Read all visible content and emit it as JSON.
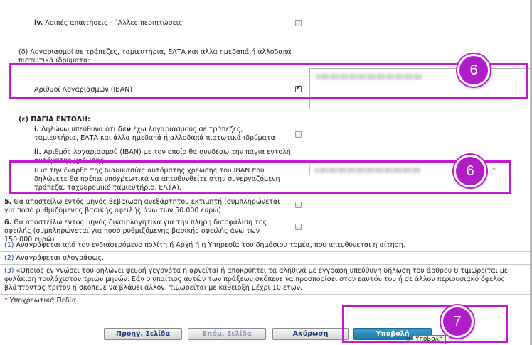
{
  "form": {
    "item_iv": {
      "num": "iv.",
      "label": "Λοιπές απαιτήσεις - ˙Αλλες περιπτώσεις"
    },
    "section_d": {
      "label": "(δ) Λογαριασμοί σε τράπεζες, ταμιευτήρια, ΕΛΤΑ και άλλα ημεδαπά ή αλλοδαπά πιστωτικά ιδρύματα:",
      "iban_label": "Αριθμοί Λογαριασμών (IBAN)",
      "iban_checked": true
    },
    "section_e": {
      "title": "(ε) ΠΑΓΙΑ ΕΝΤΟΛΗ:",
      "item_i_num": "i.",
      "item_i_a": "Δηλώνω υπεύθυνα ότι",
      "item_i_bold": "δεν",
      "item_i_b": "έχω λογαριασμούς σε τράπεζες, ταμιευτήρια, ΕΛΤΑ και άλλα ημεδαπά ή αλλοδαπά πιστωτικά ιδρύματα",
      "item_ii_num": "ii.",
      "item_ii_text": "Αριθμός λογαριασμού (IBAN) με τον οποίο θα συνδέσω την πάγια εντολή αυτόματης χρέωσης.",
      "item_ii_note": "(Για την έναρξη της διαδικασίας αυτόματης χρέωσης του IBAN που δηλώνετε θα πρέπει υποχρεωτικά να απευθυνθείτε στην συνεργαζόμενη τράπεζα, ταχυδρομικό ταμιευτήριο, ΕΛΤΑ).",
      "required_mark": "*"
    },
    "item_5": {
      "num": "5.",
      "text": "Θα αποστείλω εντός μηνός βεβαίωση ανεξάρτητου εκτιμητή (συμπληρώνεται για ποσό ρυθμιζόμενης βασικής οφειλής άνω των 50.000 ευρώ)"
    },
    "item_6": {
      "num": "6.",
      "text": "Θα αποστείλω εντός μηνός δικαιολογητικά για την πλήρη διασφάλιση της οφειλής (συμπληρώνεται για ποσό ρυθμιζόμενης βασικής οφειλής άνω των 150.000 ευρώ)"
    }
  },
  "notes": [
    {
      "num": "(1)",
      "text": "Αναγράφεται από τον ενδιαφερόμενο πολίτη ή Αρχή ή η Υπηρεσία του δημόσιου τομέα, που απευθύνεται η αίτηση."
    },
    {
      "num": "(2)",
      "text": "Αναγράφεται ολογράφως."
    },
    {
      "num": "(3)",
      "text": "«Όποιος εν γνώσει του δηλώνει ψευδή γεγονότα ή αρνείται ή αποκρύπτει τα αληθινά με έγγραφη υπεύθυνη δήλωση του άρθρου 8 τιμωρείται με φυλάκιση τουλάχιστον τριών μηνών. Εάν ο υπαίτιος αυτών των πράξεων σκόπευε να προσπορίσει στον εαυτόν του ή σε άλλον περιουσιακό όφελος βλάπτοντας τρίτον ή σκόπευε να βλάψει άλλον, τιμωρείται με κάθειρξη μέχρι 10 ετών."
    }
  ],
  "required_legend": {
    "mark": "*",
    "text": "Υποχρεωτικά Πεδία"
  },
  "buttons": {
    "prev": "Προηγ. Σελίδα",
    "next": "Επόμ. Σελίδα",
    "cancel": "Ακύρωση",
    "submit": "Υποβολή"
  },
  "tooltip": "Υποβολή",
  "annotations": {
    "badge_a": "6",
    "badge_b": "6",
    "badge_c": "7"
  },
  "colors": {
    "callout": "#c41bd1",
    "submit_bg": "#1f7aa4",
    "required": "#cc0000"
  }
}
